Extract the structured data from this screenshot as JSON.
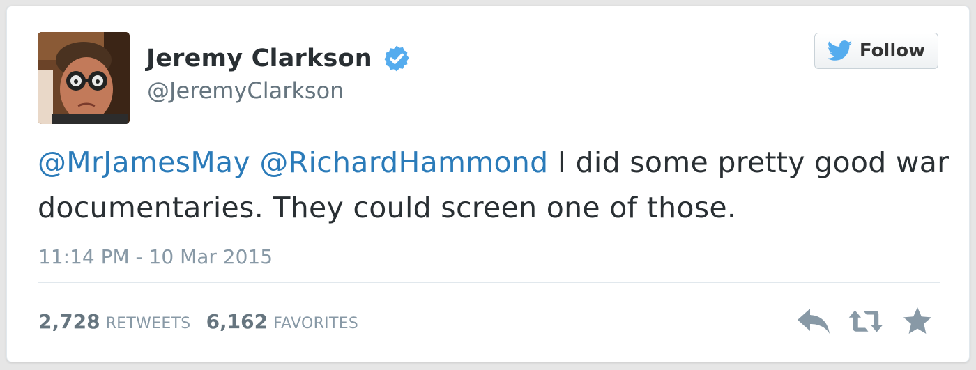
{
  "user": {
    "display_name": "Jeremy Clarkson",
    "handle": "@JeremyClarkson",
    "verified": true
  },
  "follow_button": {
    "label": "Follow",
    "icon": "twitter-bird-icon"
  },
  "tweet": {
    "mentions": [
      "@MrJamesMay",
      "@RichardHammond"
    ],
    "text": " I did some pretty good war documentaries. They could screen one of those.",
    "timestamp": "11:14 PM - 10 Mar 2015"
  },
  "stats": {
    "retweets_count": "2,728",
    "retweets_label": "RETWEETS",
    "favorites_count": "6,162",
    "favorites_label": "FAVORITES"
  },
  "actions": {
    "icons": [
      "reply-icon",
      "retweet-icon",
      "favorite-star-icon"
    ]
  },
  "colors": {
    "link": "#2b7bb9",
    "verified_badge": "#55acee",
    "twitter_bird": "#55acee",
    "text_primary": "#292f33",
    "text_secondary": "#8899a6",
    "action_icons": "#8899a6"
  }
}
